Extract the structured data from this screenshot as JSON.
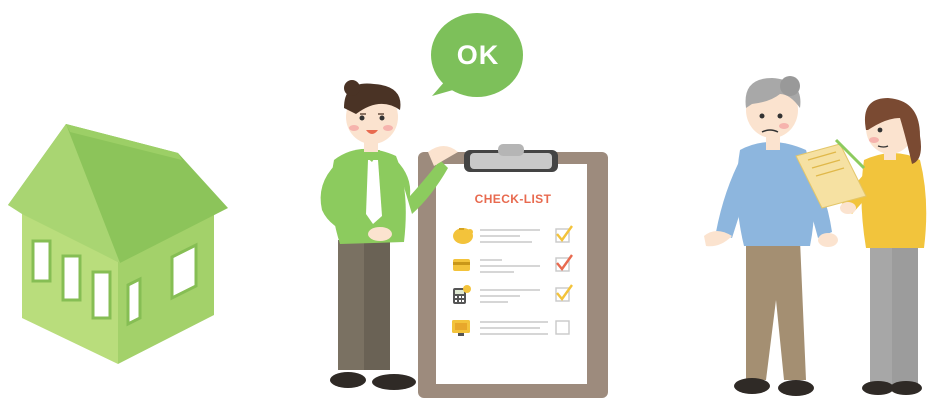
{
  "speech_bubble": {
    "text": "OK",
    "color": "#7dc05a"
  },
  "checklist": {
    "title": "CHECK-LIST",
    "items": [
      {
        "icon": "piggy-bank-icon",
        "checked": true,
        "check_color": "#f3c33b"
      },
      {
        "icon": "credit-card-icon",
        "checked": true,
        "check_color": "#e86a4f"
      },
      {
        "icon": "calculator-icon",
        "checked": true,
        "check_color": "#f3c33b"
      },
      {
        "icon": "monitor-icon",
        "checked": false,
        "check_color": "#b9b9b9"
      }
    ]
  },
  "colors": {
    "house": "#a6d365",
    "clipboard": "#9d8b7d",
    "accent_green": "#8ccb5e",
    "accent_yellow": "#f2c43c",
    "accent_orange": "#e86a4f",
    "shirt_blue": "#8db6de"
  }
}
